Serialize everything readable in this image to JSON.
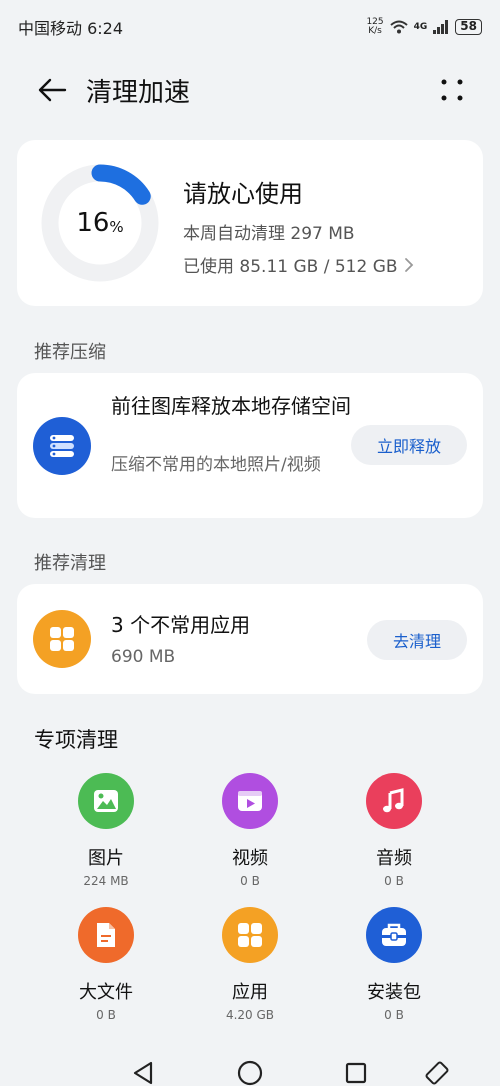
{
  "status_bar": {
    "carrier_time": "中国移动 6:24",
    "net_speed_value": "125",
    "net_speed_unit": "K/s",
    "network": "4G",
    "battery": "58"
  },
  "header": {
    "title": "清理加速",
    "back_icon": "back-arrow-icon",
    "more_icon": "more-dots-icon"
  },
  "storage": {
    "percent": "16",
    "percent_sign": "%",
    "used_fraction": 0.16,
    "headline": "请放心使用",
    "auto_clean": "本周自动清理 297 MB",
    "used": "已使用 85.11 GB / 512 GB",
    "ring_color": "#1e6fe0"
  },
  "recommend_compress": {
    "section_title": "推荐压缩",
    "title": "前往图库释放本地存储空间",
    "subtitle": "压缩不常用的本地照片/视频",
    "button": "立即释放",
    "icon_color": "#1f5fd6"
  },
  "recommend_clean": {
    "section_title": "推荐清理",
    "title": "3 个不常用应用",
    "subtitle": "690 MB",
    "button": "去清理",
    "icon_color": "#f4a124"
  },
  "special": {
    "title": "专项清理",
    "items": [
      {
        "label": "图片",
        "value": "224 MB",
        "icon": "image-icon",
        "color": "#4cbb54"
      },
      {
        "label": "视频",
        "value": "0 B",
        "icon": "video-icon",
        "color": "#b04ee0"
      },
      {
        "label": "音频",
        "value": "0 B",
        "icon": "music-icon",
        "color": "#ea3f5c"
      },
      {
        "label": "大文件",
        "value": "0 B",
        "icon": "file-icon",
        "color": "#ef6a2b"
      },
      {
        "label": "应用",
        "value": "4.20 GB",
        "icon": "apps-icon",
        "color": "#f4a124"
      },
      {
        "label": "安装包",
        "value": "0 B",
        "icon": "package-icon",
        "color": "#1f5fd6"
      }
    ]
  },
  "nav": {
    "back_icon": "nav-back-icon",
    "home_icon": "nav-home-icon",
    "recents_icon": "nav-recents-icon",
    "rotate_icon": "rotate-icon"
  }
}
